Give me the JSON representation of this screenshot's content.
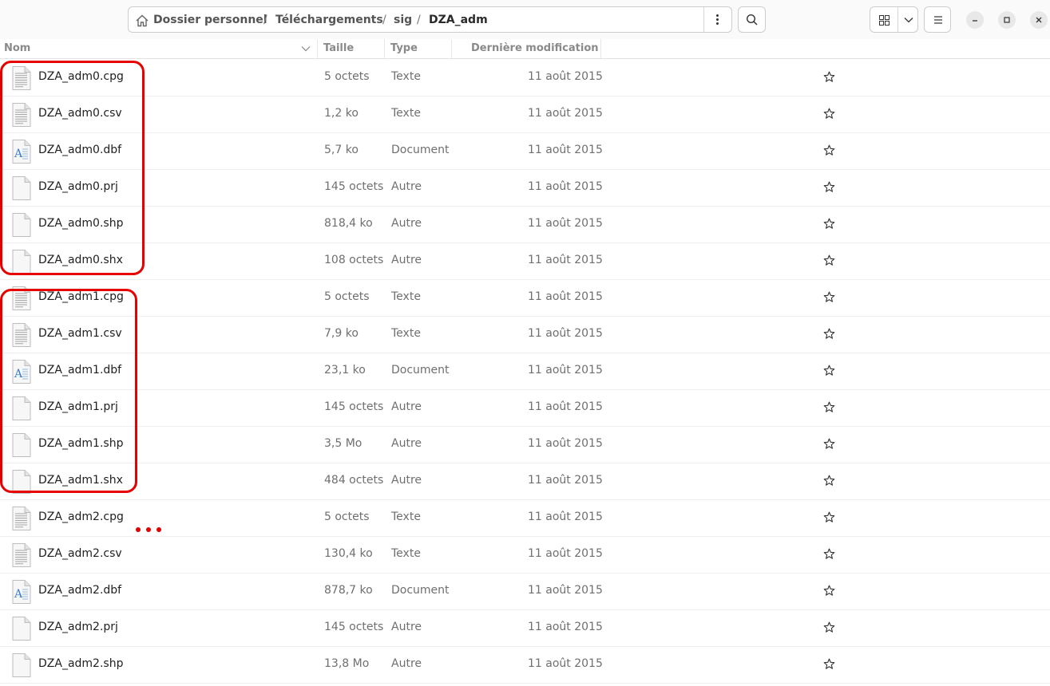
{
  "breadcrumb": [
    "Dossier personnel",
    "Téléchargements",
    "sig",
    "DZA_adm"
  ],
  "separator": "/",
  "columns": {
    "name": "Nom",
    "size": "Taille",
    "type": "Type",
    "modified": "Dernière modification"
  },
  "files": [
    {
      "name": "DZA_adm0.cpg",
      "size": "5 octets",
      "type": "Texte",
      "modified": "11 août 2015",
      "icon": "text-file-icon"
    },
    {
      "name": "DZA_adm0.csv",
      "size": "1,2 ko",
      "type": "Texte",
      "modified": "11 août 2015",
      "icon": "text-file-icon"
    },
    {
      "name": "DZA_adm0.dbf",
      "size": "5,7 ko",
      "type": "Document",
      "modified": "11 août 2015",
      "icon": "document-file-icon"
    },
    {
      "name": "DZA_adm0.prj",
      "size": "145 octets",
      "type": "Autre",
      "modified": "11 août 2015",
      "icon": "generic-file-icon"
    },
    {
      "name": "DZA_adm0.shp",
      "size": "818,4 ko",
      "type": "Autre",
      "modified": "11 août 2015",
      "icon": "generic-file-icon"
    },
    {
      "name": "DZA_adm0.shx",
      "size": "108 octets",
      "type": "Autre",
      "modified": "11 août 2015",
      "icon": "generic-file-icon"
    },
    {
      "name": "DZA_adm1.cpg",
      "size": "5 octets",
      "type": "Texte",
      "modified": "11 août 2015",
      "icon": "text-file-icon"
    },
    {
      "name": "DZA_adm1.csv",
      "size": "7,9 ko",
      "type": "Texte",
      "modified": "11 août 2015",
      "icon": "text-file-icon"
    },
    {
      "name": "DZA_adm1.dbf",
      "size": "23,1 ko",
      "type": "Document",
      "modified": "11 août 2015",
      "icon": "document-file-icon"
    },
    {
      "name": "DZA_adm1.prj",
      "size": "145 octets",
      "type": "Autre",
      "modified": "11 août 2015",
      "icon": "generic-file-icon"
    },
    {
      "name": "DZA_adm1.shp",
      "size": "3,5 Mo",
      "type": "Autre",
      "modified": "11 août 2015",
      "icon": "generic-file-icon"
    },
    {
      "name": "DZA_adm1.shx",
      "size": "484 octets",
      "type": "Autre",
      "modified": "11 août 2015",
      "icon": "generic-file-icon"
    },
    {
      "name": "DZA_adm2.cpg",
      "size": "5 octets",
      "type": "Texte",
      "modified": "11 août 2015",
      "icon": "text-file-icon"
    },
    {
      "name": "DZA_adm2.csv",
      "size": "130,4 ko",
      "type": "Texte",
      "modified": "11 août 2015",
      "icon": "text-file-icon"
    },
    {
      "name": "DZA_adm2.dbf",
      "size": "878,7 ko",
      "type": "Document",
      "modified": "11 août 2015",
      "icon": "document-file-icon"
    },
    {
      "name": "DZA_adm2.prj",
      "size": "145 octets",
      "type": "Autre",
      "modified": "11 août 2015",
      "icon": "generic-file-icon"
    },
    {
      "name": "DZA_adm2.shp",
      "size": "13,8 Mo",
      "type": "Autre",
      "modified": "11 août 2015",
      "icon": "generic-file-icon"
    }
  ],
  "annotation_color": "#e60000"
}
